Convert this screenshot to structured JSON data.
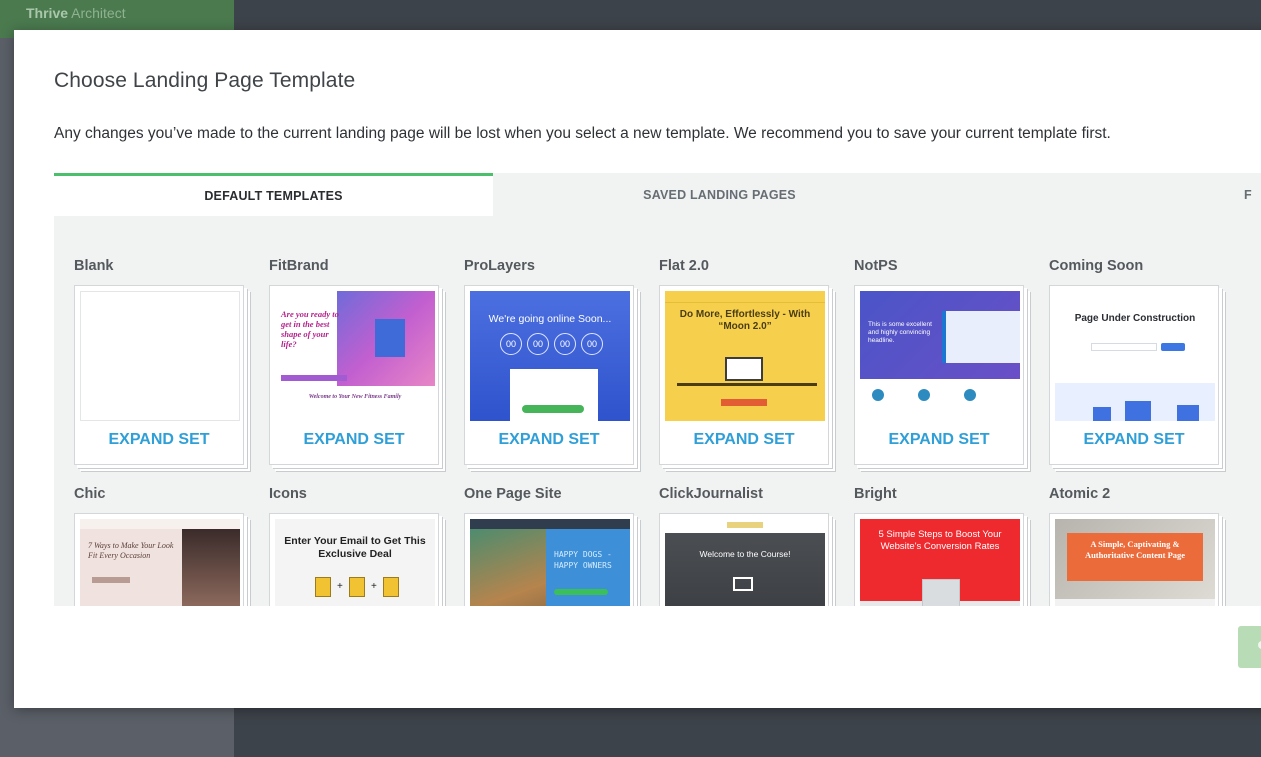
{
  "background_app": {
    "brand": "Thrive",
    "brand_suffix": " Architect"
  },
  "modal": {
    "title": "Choose Landing Page Template",
    "warning": "Any changes you’ve made to the current landing page will be lost when you select a new template. We recommend you to save your current template first."
  },
  "tabs": [
    {
      "label": "DEFAULT TEMPLATES",
      "active": true
    },
    {
      "label": "SAVED LANDING PAGES",
      "active": false
    },
    {
      "label": "F",
      "active": false
    }
  ],
  "expand_label": "EXPAND SET",
  "templates": [
    {
      "name": "Blank"
    },
    {
      "name": "FitBrand"
    },
    {
      "name": "ProLayers"
    },
    {
      "name": "Flat 2.0"
    },
    {
      "name": "NotPS"
    },
    {
      "name": "Coming Soon"
    },
    {
      "name": "Chic"
    },
    {
      "name": "Icons"
    },
    {
      "name": "One Page Site"
    },
    {
      "name": "ClickJournalist"
    },
    {
      "name": "Bright"
    },
    {
      "name": "Atomic 2"
    }
  ],
  "thumbnails": {
    "fitbrand_headline": "Are you ready to get in the best shape of your life?",
    "fitbrand_footer": "Welcome to Your New Fitness Family",
    "prolayers_headline": "We're going online Soon...",
    "prolayers_counter": [
      "00",
      "00",
      "00",
      "00"
    ],
    "flat_headline": "Do More, Effortlessly - With “Moon 2.0”",
    "notps_headline": "This is some excellent and highly convincing headline.",
    "coming_soon_headline": "Page Under Construction",
    "chic_headline": "7 Ways to Make Your Look Fit Every Occasion",
    "icons_headline": "Enter Your Email to Get This Exclusive Deal",
    "ops_headline": "HAPPY DOGS - HAPPY OWNERS",
    "cj_headline": "Welcome to the Course!",
    "bright_headline": "5 Simple Steps to Boost Your Website's Conversion Rates",
    "atomic_headline": "A Simple, Captivating & Authoritative Content Page"
  },
  "colors": {
    "accent_green": "#4bbf6b",
    "expand_blue": "#2f9fd8",
    "modal_bg": "#ffffff",
    "grid_bg": "#f1f3f3"
  }
}
